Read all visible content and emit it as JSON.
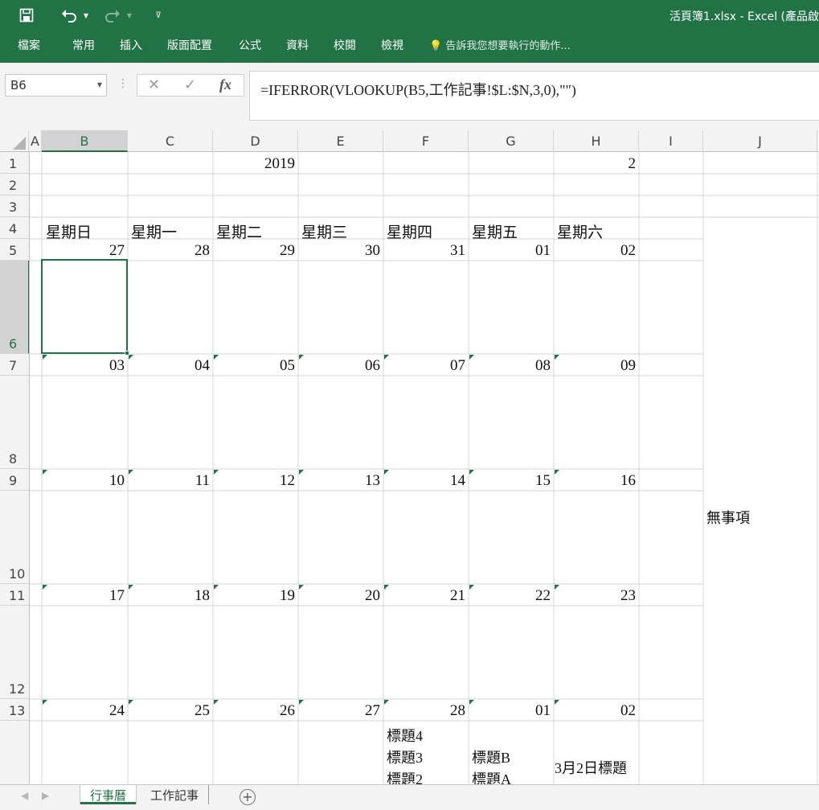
{
  "window": {
    "title": "活頁簿1.xlsx - Excel (產品啟",
    "quick_access": {
      "save_icon": "save-icon",
      "undo_icon": "undo-icon",
      "redo_icon": "redo-icon",
      "customize_icon": "customize-icon"
    }
  },
  "ribbon": {
    "tabs": [
      "檔案",
      "常用",
      "插入",
      "版面配置",
      "公式",
      "資料",
      "校閱",
      "檢視"
    ],
    "tell_me": "告訴我您想要執行的動作..."
  },
  "formula_bar": {
    "name_box": "B6",
    "cancel": "✕",
    "enter": "✓",
    "fx": "fx",
    "formula": "=IFERROR(VLOOKUP(B5,工作記事!$L:$N,3,0),\"\")"
  },
  "columns": [
    "A",
    "B",
    "C",
    "D",
    "E",
    "F",
    "G",
    "H",
    "I",
    "J"
  ],
  "rows": [
    "1",
    "2",
    "3",
    "4",
    "5",
    "6",
    "7",
    "8",
    "9",
    "10",
    "11",
    "12",
    "13"
  ],
  "sheet": {
    "year": "2019",
    "month": "2",
    "weekdays": [
      "星期日",
      "星期一",
      "星期二",
      "星期三",
      "星期四",
      "星期五",
      "星期六"
    ],
    "weeks": [
      [
        "27",
        "28",
        "29",
        "30",
        "31",
        "01",
        "02"
      ],
      [
        "03",
        "04",
        "05",
        "06",
        "07",
        "08",
        "09"
      ],
      [
        "10",
        "11",
        "12",
        "13",
        "14",
        "15",
        "16"
      ],
      [
        "17",
        "18",
        "19",
        "20",
        "21",
        "22",
        "23"
      ],
      [
        "24",
        "25",
        "26",
        "27",
        "28",
        "01",
        "02"
      ]
    ],
    "no_events": "無事項",
    "events_f": [
      "標題4",
      "標題3",
      "標題2"
    ],
    "events_g": [
      "標題B",
      "標題A"
    ],
    "events_h": "3月2日標題"
  },
  "sheet_tabs": [
    "行事曆",
    "工作記事"
  ],
  "active_sheet": "行事曆"
}
